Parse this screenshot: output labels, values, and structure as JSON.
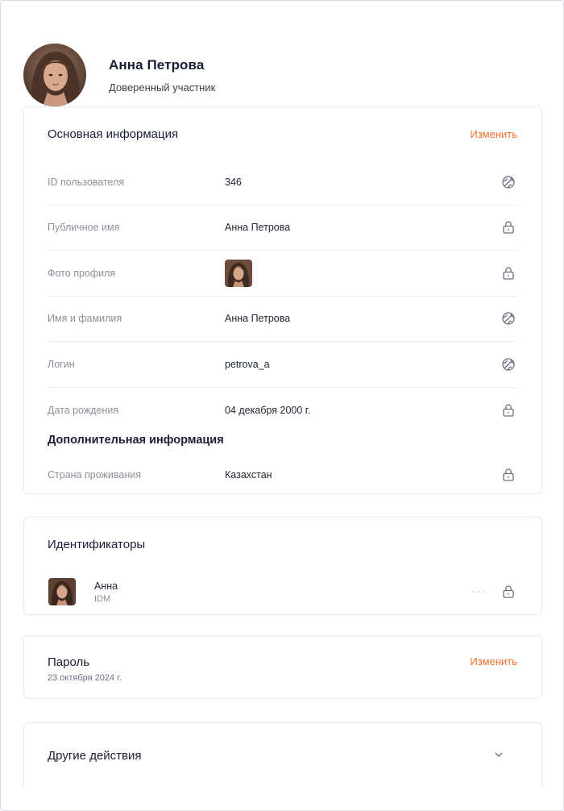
{
  "profile": {
    "name": "Анна Петрова",
    "role": "Доверенный участник"
  },
  "basic_info": {
    "title": "Основная информация",
    "edit_label": "Изменить",
    "rows": [
      {
        "label": "ID пользователя",
        "value": "346",
        "icon": "globe-off-icon"
      },
      {
        "label": "Публичное имя",
        "value": "Анна Петрова",
        "icon": "lock-icon"
      },
      {
        "label": "Фото профиля",
        "value": "",
        "icon": "lock-icon"
      },
      {
        "label": "Имя и фамилия",
        "value": "Анна Петрова",
        "icon": "globe-off-icon"
      },
      {
        "label": "Логин",
        "value": "petrova_a",
        "icon": "globe-off-icon"
      },
      {
        "label": "Дата рождения",
        "value": "04 декабря 2000 г.",
        "icon": "lock-icon"
      }
    ],
    "extra_title": "Дополнительная информация",
    "extra_rows": [
      {
        "label": "Страна проживания",
        "value": "Казахстан",
        "icon": "lock-icon"
      }
    ]
  },
  "identifiers": {
    "title": "Идентификаторы",
    "items": [
      {
        "name": "Анна",
        "type": "IDM",
        "menu": "···",
        "icon": "lock-icon"
      }
    ]
  },
  "password": {
    "title": "Пароль",
    "date": "23 октября 2024 г.",
    "edit_label": "Изменить"
  },
  "other_actions": {
    "title": "Другие действия",
    "icon": "chevron-down-icon"
  },
  "colors": {
    "accent": "#f36c2c",
    "border": "#e6e8ec",
    "label": "#8c909c"
  }
}
